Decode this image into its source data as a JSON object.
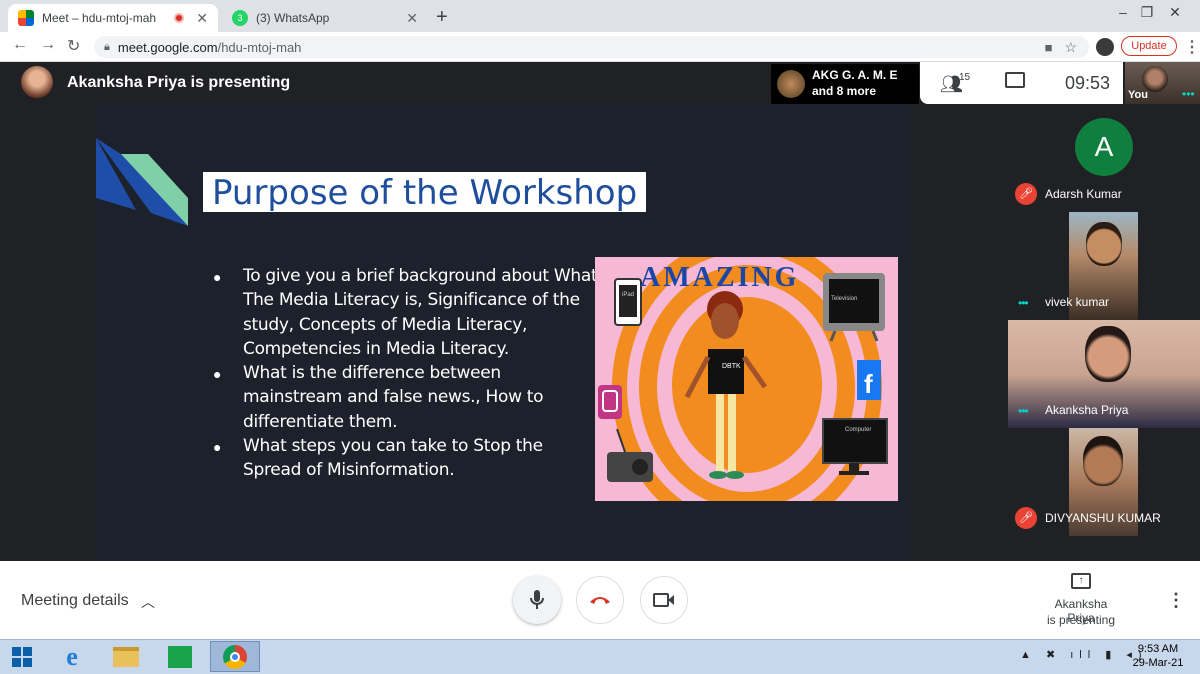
{
  "browser": {
    "tabs": [
      {
        "title": "Meet – hdu-mtoj-mah",
        "favicon": "google-meet-icon",
        "recording": true
      },
      {
        "title": "(3) WhatsApp",
        "favicon": "whatsapp-icon",
        "badge": "3"
      }
    ],
    "url_host": "meet.google.com",
    "url_path": "/hdu-mtoj-mah",
    "update_label": "Update"
  },
  "meet_header": {
    "presenting_title": "Akanksha Priya is presenting",
    "group_name": "AKG G. A. M. E",
    "group_more": "and 8 more",
    "people_count": "15",
    "clock": "09:53",
    "self_label": "You"
  },
  "slide": {
    "title": "Purpose of the Workshop",
    "bullets": [
      [
        "To give you a brief background about What",
        "The Media Literacy is, Significance of the",
        "study, Concepts of Media Literacy,",
        "Competencies in Media Literacy."
      ],
      [
        "What is  the difference between",
        "mainstream and false news., How to",
        "differentiate them."
      ],
      [
        "What steps you can take to  Stop the",
        "Spread of Misinformation."
      ]
    ],
    "illustration": {
      "word": "AMAZING",
      "shirt_text": "DBTK",
      "tv_label": "Television",
      "computer_label": "Computer",
      "phone_label": "iPad"
    }
  },
  "participants": [
    {
      "name": "Adarsh Kumar",
      "initial": "A",
      "muted": true
    },
    {
      "name": "vivek kumar",
      "muted": false
    },
    {
      "name": "Akanksha Priya",
      "muted": false
    },
    {
      "name": "DIVYANSHU KUMAR",
      "muted": true
    }
  ],
  "bottom_bar": {
    "meeting_details": "Meeting details",
    "presenting_line1": "Akanksha Priya",
    "presenting_line2": "is presenting"
  },
  "taskbar": {
    "time": "9:53 AM",
    "date": "29-Mar-21"
  },
  "colors": {
    "meet_dark": "#202124",
    "slide_bg": "#1c212c",
    "title_blue": "#1f4e9c",
    "mute_red": "#ea4335",
    "accent_teal": "#00d7c7"
  }
}
